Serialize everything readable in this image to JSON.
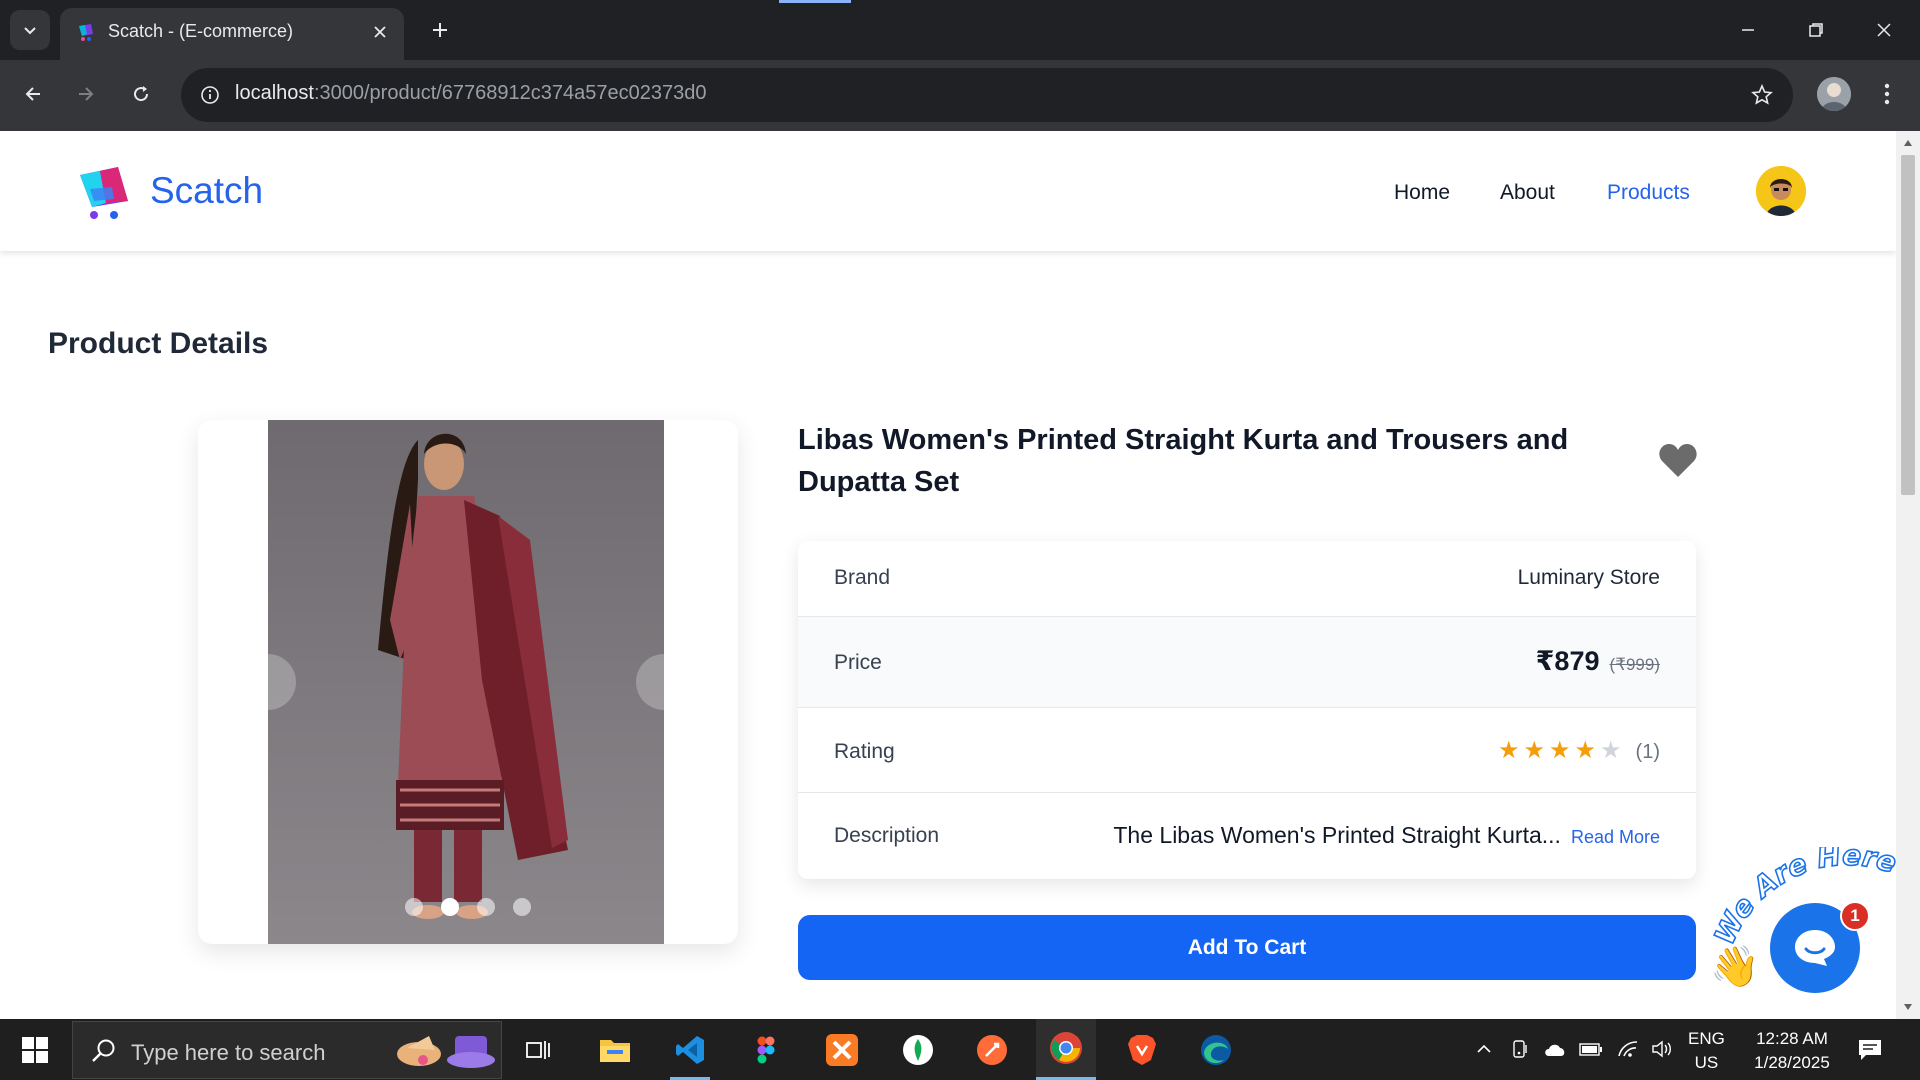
{
  "browser": {
    "tab_title": "Scatch - (E-commerce)",
    "url_host": "localhost",
    "url_rest": ":3000/product/67768912c374a57ec02373d0"
  },
  "site": {
    "brand": "Scatch",
    "nav": [
      {
        "label": "Home"
      },
      {
        "label": "About"
      },
      {
        "label": "Products"
      }
    ]
  },
  "page": {
    "heading": "Product Details"
  },
  "product": {
    "title": "Libas Women's Printed Straight Kurta and Trousers and Dupatta Set",
    "brand_label": "Brand",
    "brand_value": "Luminary Store",
    "price_label": "Price",
    "price": "₹879",
    "price_old": "(₹999)",
    "rating_label": "Rating",
    "rating_stars": 4,
    "rating_max": 5,
    "rating_count": "(1)",
    "description_label": "Description",
    "description_preview": "The Libas Women's Printed Straight Kurta...",
    "read_more": "Read More",
    "carousel_slides": 4,
    "carousel_active": 2
  },
  "cta": {
    "add_to_cart": "Add To Cart"
  },
  "chat": {
    "badge_count": "1",
    "tagline": "We Are Here!"
  },
  "taskbar": {
    "search_placeholder": "Type here to search",
    "lang_primary": "ENG",
    "lang_secondary": "US",
    "time": "12:28 AM",
    "date": "1/28/2025"
  },
  "colors": {
    "accent": "#2563eb",
    "cta": "#1565f5",
    "star": "#f59e0b"
  }
}
